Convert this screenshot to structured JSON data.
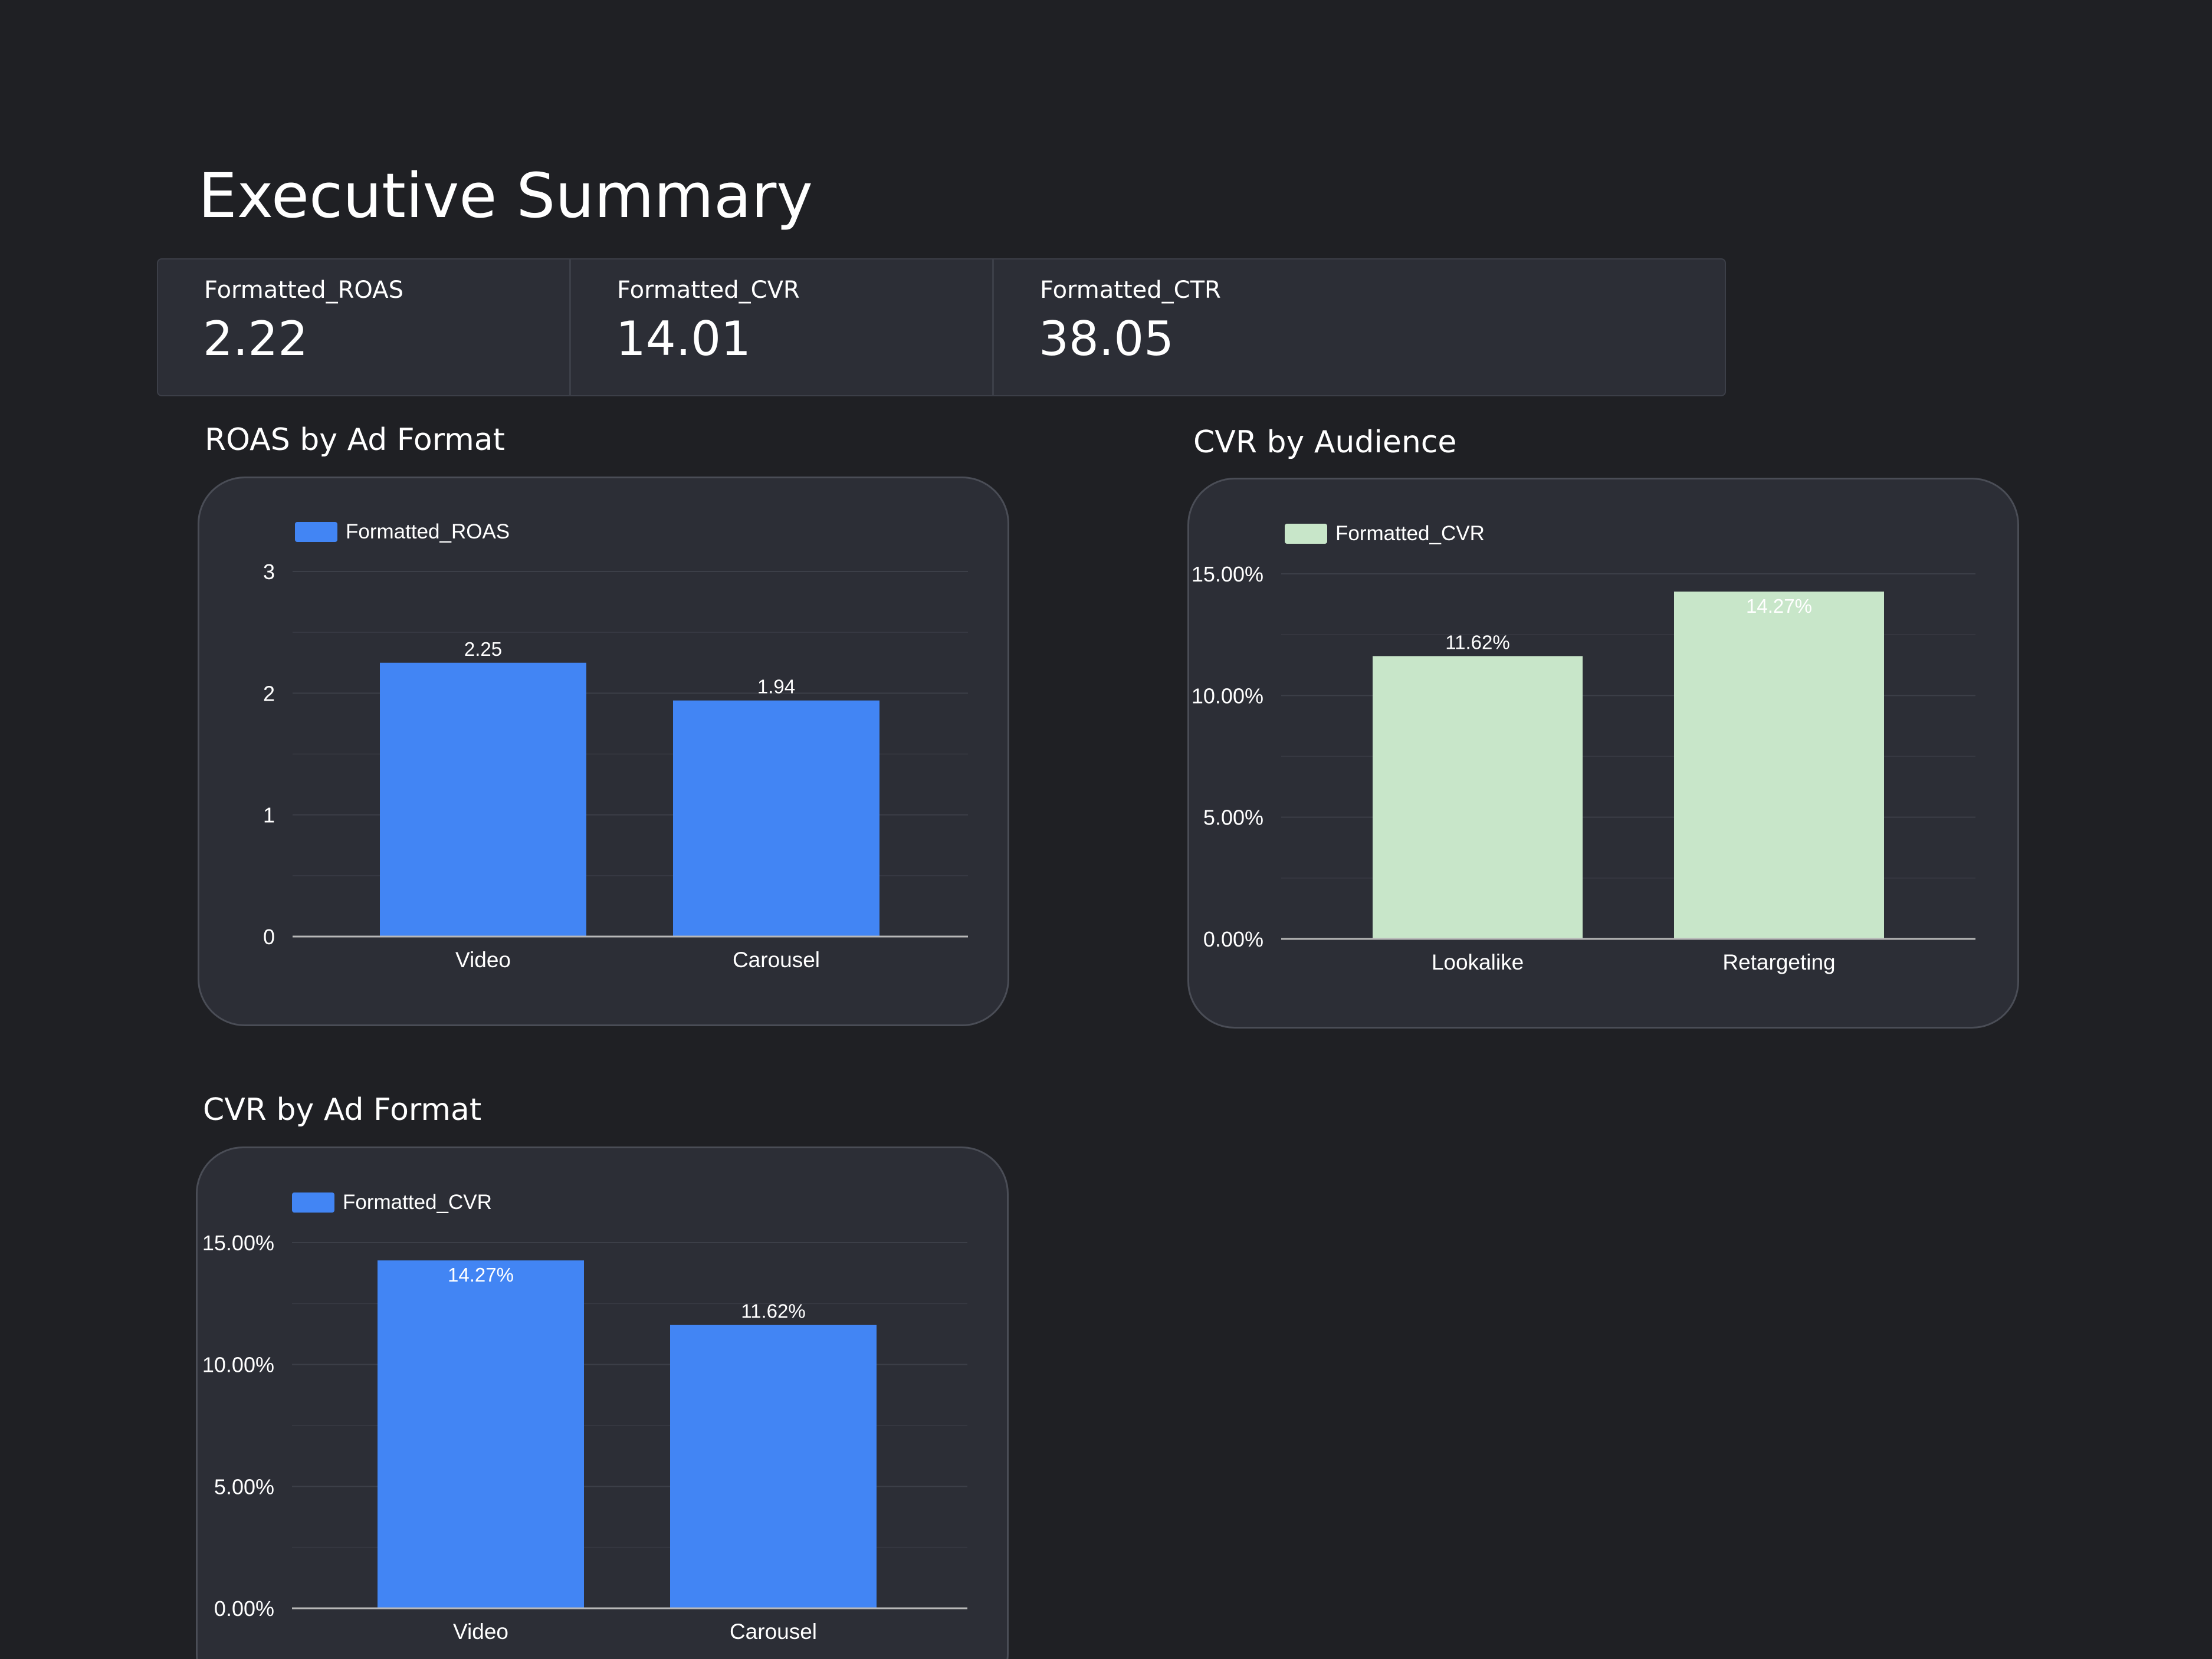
{
  "page": {
    "title": "Executive Summary"
  },
  "kpis": [
    {
      "label": "Formatted_ROAS",
      "value": "2.22"
    },
    {
      "label": "Formatted_CVR",
      "value": "14.01"
    },
    {
      "label": "Formatted_CTR",
      "value": "38.05"
    }
  ],
  "colors": {
    "blue": "#4285f4",
    "mint": "#c8e6c9",
    "background": "#1f2024",
    "card": "#2c2e36",
    "grid": "#3c3f48",
    "axis": "#b8b8b8"
  },
  "chart_data": [
    {
      "id": "roas-by-ad-format",
      "type": "bar",
      "title": "ROAS by Ad Format",
      "xlabel": "",
      "ylabel": "",
      "categories": [
        "Video",
        "Carousel"
      ],
      "series": [
        {
          "name": "Formatted_ROAS",
          "values": [
            2.25,
            1.94
          ]
        }
      ],
      "data_labels": [
        "2.25",
        "1.94"
      ],
      "ylim": [
        0,
        3
      ],
      "yticks": [
        0,
        1,
        2,
        3
      ],
      "ytick_labels": [
        "0",
        "1",
        "2",
        "3"
      ],
      "color": "#4285f4",
      "grid": true,
      "legend": "top-left",
      "label_position": "above"
    },
    {
      "id": "cvr-by-audience",
      "type": "bar",
      "title": "CVR by Audience",
      "xlabel": "",
      "ylabel": "",
      "categories": [
        "Lookalike",
        "Retargeting"
      ],
      "series": [
        {
          "name": "Formatted_CVR",
          "values": [
            11.62,
            14.27
          ]
        }
      ],
      "data_labels": [
        "11.62%",
        "14.27%"
      ],
      "ylim": [
        0,
        15
      ],
      "yticks": [
        0,
        5,
        10,
        15
      ],
      "ytick_labels": [
        "0.00%",
        "5.00%",
        "10.00%",
        "15.00%"
      ],
      "color": "#c8e6c9",
      "grid": true,
      "legend": "top-left",
      "label_position": [
        "above",
        "inside"
      ]
    },
    {
      "id": "cvr-by-ad-format",
      "type": "bar",
      "title": "CVR by Ad Format",
      "xlabel": "",
      "ylabel": "",
      "categories": [
        "Video",
        "Carousel"
      ],
      "series": [
        {
          "name": "Formatted_CVR",
          "values": [
            14.27,
            11.62
          ]
        }
      ],
      "data_labels": [
        "14.27%",
        "11.62%"
      ],
      "ylim": [
        0,
        15
      ],
      "yticks": [
        0,
        5,
        10,
        15
      ],
      "ytick_labels": [
        "0.00%",
        "5.00%",
        "10.00%",
        "15.00%"
      ],
      "color": "#4285f4",
      "grid": true,
      "legend": "top-left",
      "label_position": [
        "inside",
        "above"
      ]
    }
  ]
}
